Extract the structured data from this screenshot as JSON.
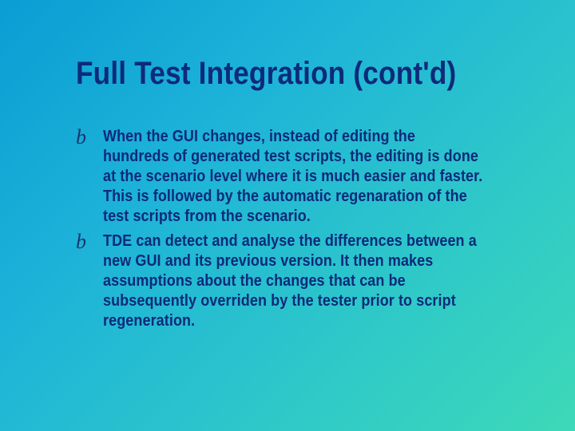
{
  "slide": {
    "title": "Full Test Integration (cont'd)",
    "bullets": [
      {
        "marker": "b",
        "text": "When the GUI changes, instead of editing the hundreds of generated test scripts, the editing is done at the scenario level where it is much easier and faster. This is followed by the automatic regenaration of the test scripts from the scenario."
      },
      {
        "marker": "b",
        "text": "TDE can detect and analyse the differences between a new GUI and its previous version. It then makes assumptions about the changes that can be subsequently overriden by the tester prior to script regeneration."
      }
    ]
  }
}
